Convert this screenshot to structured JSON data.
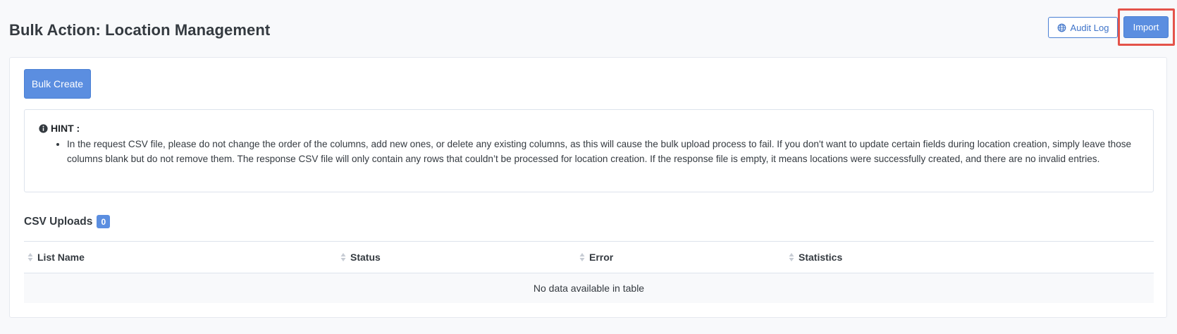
{
  "page": {
    "title": "Bulk Action: Location Management"
  },
  "header_actions": {
    "audit_log_label": "Audit Log",
    "import_label": "Import"
  },
  "card": {
    "bulk_create_label": "Bulk Create",
    "hint": {
      "title": "HINT :",
      "items": [
        "In the request CSV file, please do not change the order of the columns, add new ones, or delete any existing columns, as this will cause the bulk upload process to fail. If you don't want to update certain fields during location creation, simply leave those columns blank but do not remove them. The response CSV file will only contain any rows that couldn’t be processed for location creation. If the response file is empty, it means locations were successfully created, and there are no invalid entries."
      ]
    },
    "uploads": {
      "title": "CSV Uploads",
      "count": "0",
      "columns": [
        "List Name",
        "Status",
        "Error",
        "Statistics"
      ],
      "empty_message": "No data available in table"
    }
  },
  "colors": {
    "primary": "#5b8ee0",
    "primary_border": "#4a80d4",
    "highlight": "#e4534a",
    "page_bg": "#f8f9fb"
  },
  "icons": {
    "audit_log": "globe-icon",
    "hint": "info-circle-icon",
    "sort": "sort-icon"
  }
}
